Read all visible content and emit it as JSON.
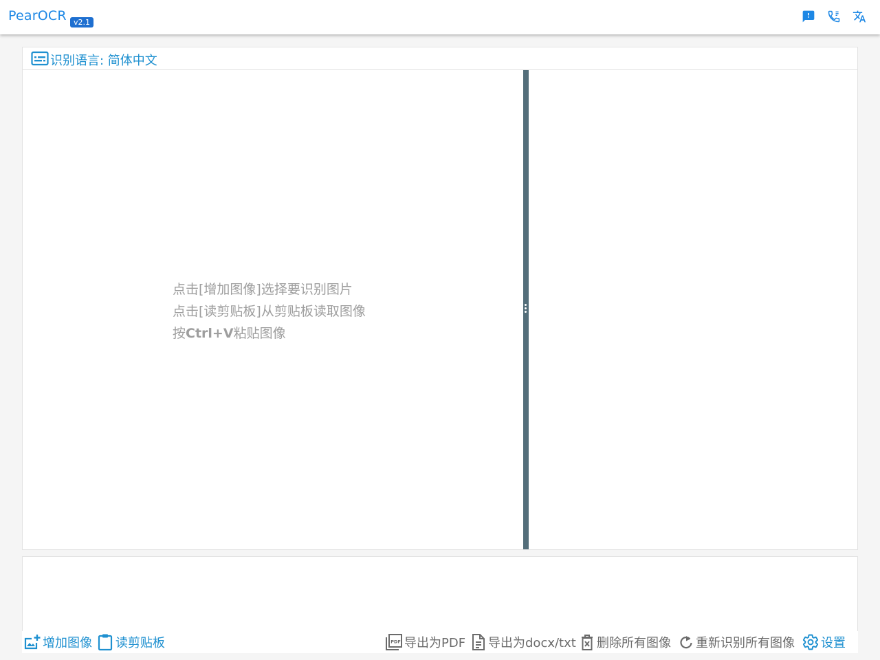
{
  "header": {
    "app_title": "PearOCR",
    "version": "v2.1",
    "icons": [
      "feedback-icon",
      "contact-phone-icon",
      "translate-icon"
    ]
  },
  "ocr_panel": {
    "language_label": "识别语言: 简体中文",
    "hints": [
      "点击[增加图像]选择要识别图片",
      "点击[读剪贴板]从剪贴板读取图像"
    ],
    "hint_paste": {
      "prefix": "按",
      "keys": "Ctrl+V",
      "suffix": "粘贴图像"
    }
  },
  "toolbar": {
    "add_image": "增加图像",
    "read_clipboard": "读剪贴板",
    "export_pdf": "导出为PDF",
    "export_docx": "导出为docx/txt",
    "delete_all": "删除所有图像",
    "rerecognize_all": "重新识别所有图像",
    "settings": "设置"
  },
  "colors": {
    "accent": "#1e90d0",
    "badge": "#1e6fd0",
    "divider": "#546e7a",
    "hint_text": "#9e9e9e",
    "toolbar_grey": "#6b6b6b"
  }
}
